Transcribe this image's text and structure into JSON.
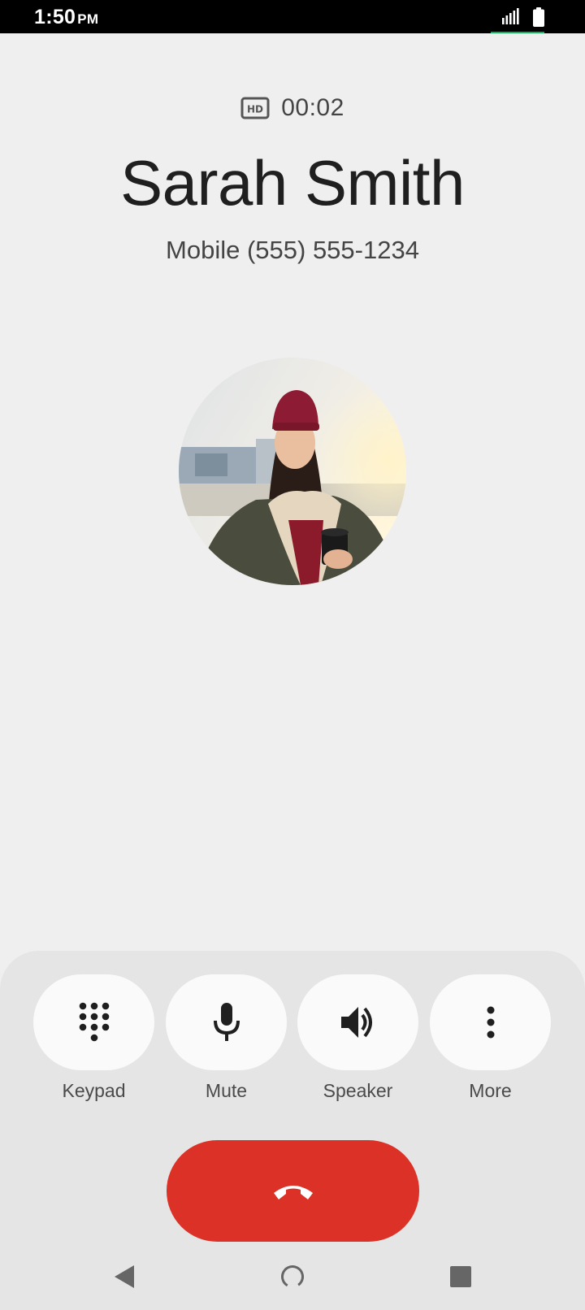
{
  "status_bar": {
    "time": "1:50",
    "ampm": "PM",
    "icons": [
      "signal-icon",
      "battery-icon"
    ]
  },
  "call": {
    "hd_badge": "HD",
    "timer": "00:02",
    "caller_name": "Sarah Smith",
    "caller_number": "Mobile (555) 555-1234"
  },
  "controls": [
    {
      "id": "keypad",
      "label": "Keypad",
      "icon": "dialpad-icon"
    },
    {
      "id": "mute",
      "label": "Mute",
      "icon": "microphone-icon"
    },
    {
      "id": "speaker",
      "label": "Speaker",
      "icon": "speaker-icon"
    },
    {
      "id": "more",
      "label": "More",
      "icon": "more-vertical-icon"
    }
  ],
  "end_call": {
    "icon": "end-call-icon",
    "color": "#dc3126"
  },
  "nav": [
    "back-icon",
    "home-icon",
    "recents-icon"
  ],
  "colors": {
    "background": "#efefef",
    "sheet": "#e5e5e5",
    "end_call": "#dc3126",
    "status_accent": "#13b35c"
  }
}
